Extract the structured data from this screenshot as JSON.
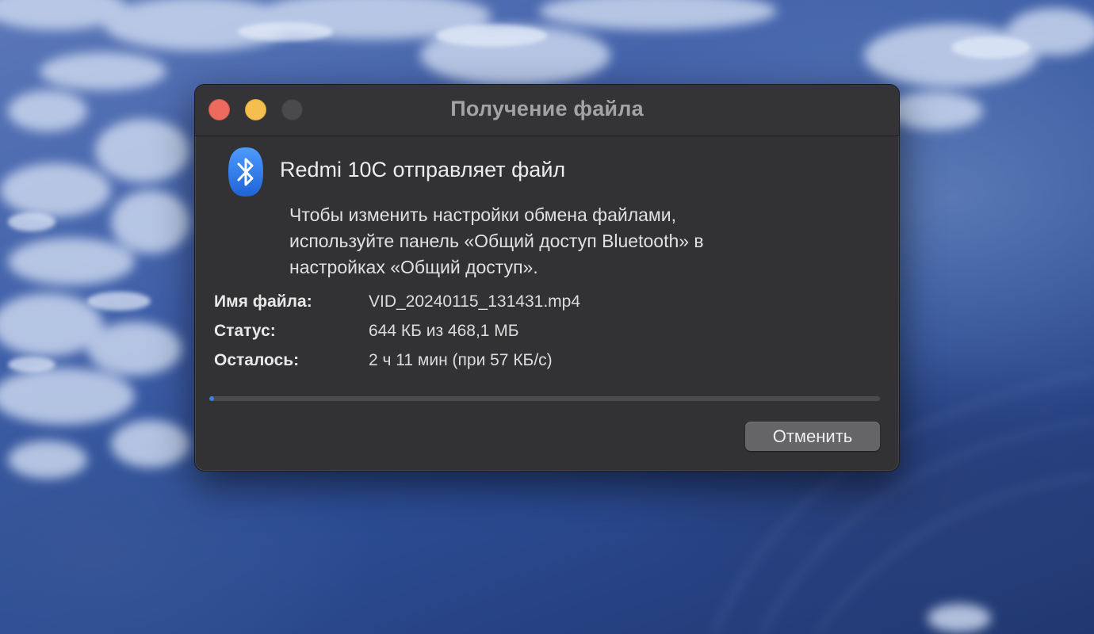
{
  "window": {
    "title": "Получение файла",
    "controls": {
      "close_color": "#ed6a5e",
      "minimize_color": "#f5bf4f",
      "zoom_color": "#4a4a4c"
    }
  },
  "icon": "bluetooth-icon",
  "heading": "Redmi 10C отправляет файл",
  "info_lines": [
    "Чтобы изменить настройки обмена файлами,",
    "используйте панель «Общий доступ Bluetooth» в",
    "настройках «Общий доступ»."
  ],
  "fields": [
    {
      "label": "Имя файла:",
      "value": "VID_20240115_131431.mp4"
    },
    {
      "label": "Статус:",
      "value": "644 КБ из 468,1 МБ"
    },
    {
      "label": "Осталось:",
      "value": "2 ч 11 мин (при 57 КБ/с)"
    }
  ],
  "progress": {
    "percent": 0.13
  },
  "buttons": {
    "cancel_label": "Отменить"
  },
  "colors": {
    "accent": "#3f7fe0",
    "bluetooth_badge": "#2f7cf6"
  }
}
